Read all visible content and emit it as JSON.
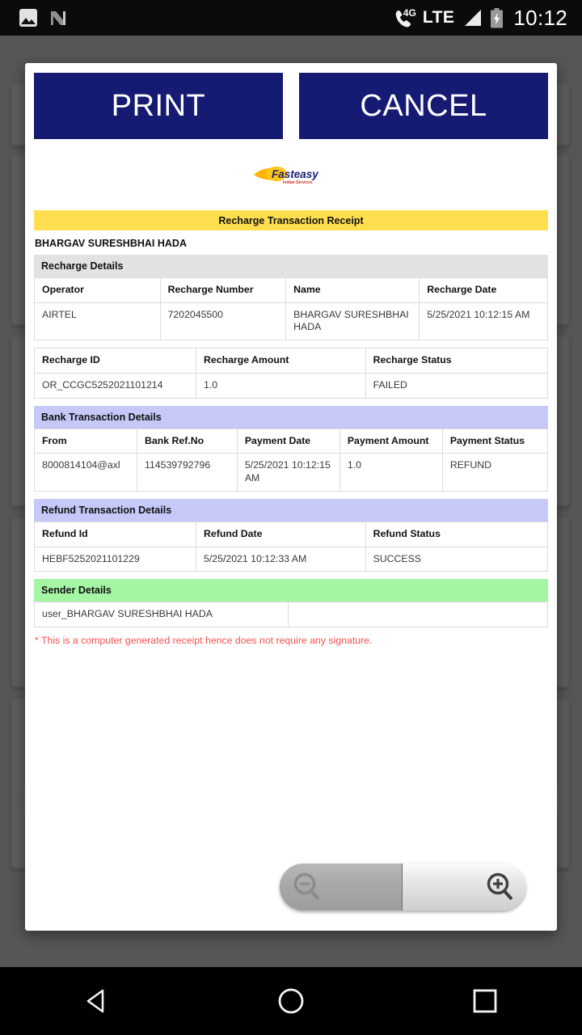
{
  "statusbar": {
    "icons": [
      "screenshot-icon",
      "android-n-icon",
      "phone-4g-icon",
      "signal-icon",
      "battery-charging-icon"
    ],
    "network_4g": "4G",
    "network_lte": "LTE",
    "clock": "10:12"
  },
  "dialog": {
    "buttons": {
      "print": "PRINT",
      "cancel": "CANCEL"
    },
    "logo": {
      "name": "Fasteasy",
      "tagline": "Indian Services",
      "brand_color": "#1b1f77",
      "flame_color": "#ffb400"
    }
  },
  "receipt": {
    "title": "Recharge Transaction Receipt",
    "customer_name": "BHARGAV SURESHBHAI HADA",
    "note": "* This is a computer generated receipt hence does not require any signature.",
    "sections": [
      {
        "heading": "Recharge Details",
        "heading_color": "#e2e2e2",
        "tables": [
          {
            "headers": [
              "Operator",
              "Recharge Number",
              "Name",
              "Recharge Date"
            ],
            "row": [
              "AIRTEL",
              "7202045500",
              "BHARGAV SURESHBHAI HADA",
              "5/25/2021 10:12:15 AM"
            ]
          },
          {
            "headers": [
              "Recharge ID",
              "Recharge Amount",
              "Recharge Status"
            ],
            "row": [
              "OR_CCGC5252021101214",
              "1.0",
              "FAILED"
            ]
          }
        ]
      },
      {
        "heading": "Bank Transaction Details",
        "heading_color": "#c6c8f8",
        "tables": [
          {
            "headers": [
              "From",
              "Bank Ref.No",
              "Payment Date",
              "Payment Amount",
              "Payment Status"
            ],
            "row": [
              "8000814104@axl",
              "114539792796",
              "5/25/2021 10:12:15 AM",
              "1.0",
              "REFUND"
            ]
          }
        ]
      },
      {
        "heading": "Refund Transaction Details",
        "heading_color": "#c6c8f8",
        "tables": [
          {
            "headers": [
              "Refund Id",
              "Refund Date",
              "Refund Status"
            ],
            "row": [
              "HEBF5252021101229",
              "5/25/2021 10:12:33 AM",
              "SUCCESS"
            ]
          }
        ]
      },
      {
        "heading": "Sender Details",
        "heading_color": "#a4f5a4",
        "tables": [
          {
            "headers": [],
            "row": [
              "user_BHARGAV SURESHBHAI HADA",
              ""
            ]
          }
        ]
      }
    ]
  },
  "zoom_control": {
    "zoom_out_label": "zoom-out",
    "zoom_in_label": "zoom-in",
    "zoom_out_enabled": "false",
    "zoom_in_enabled": "true"
  },
  "navbar": {
    "back": "back",
    "home": "home",
    "recents": "recents"
  }
}
